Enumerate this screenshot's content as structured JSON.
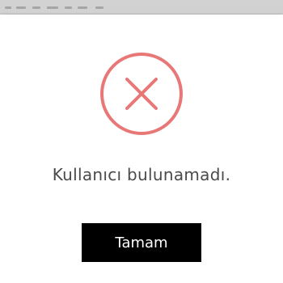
{
  "dialog": {
    "message": "Kullanıcı bulunamadı.",
    "ok_label": "Tamam",
    "icon": "error-x-circle-icon",
    "icon_color": "#e87777",
    "button_color": "#000000"
  }
}
